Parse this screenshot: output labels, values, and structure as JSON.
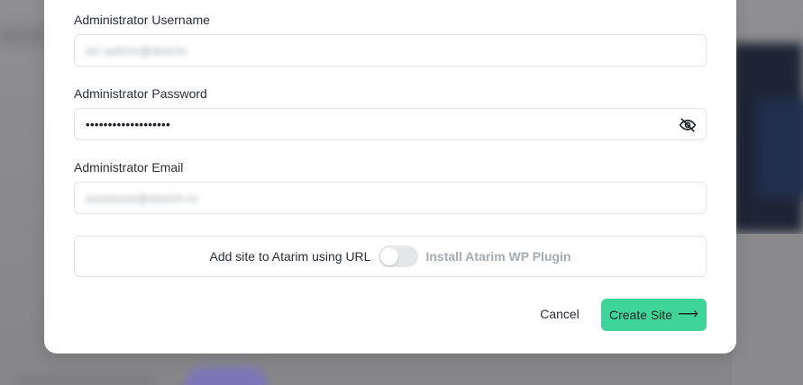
{
  "form": {
    "username": {
      "label": "Administrator Username",
      "value": "wc-admin@atarim"
    },
    "password": {
      "label": "Administrator Password",
      "value": "•••••••••••••••••••"
    },
    "email": {
      "label": "Administrator Email",
      "value": "someone@atarim.io"
    }
  },
  "atarim": {
    "label_left": "Add site to Atarim using URL",
    "label_right": "Install Atarim WP Plugin",
    "toggle_on": false
  },
  "actions": {
    "cancel_label": "Cancel",
    "create_label": "Create Site",
    "create_arrow": "⟶"
  },
  "colors": {
    "primary": "#3fd598",
    "muted_text": "#a5abb3",
    "border": "#e3e5e9"
  }
}
